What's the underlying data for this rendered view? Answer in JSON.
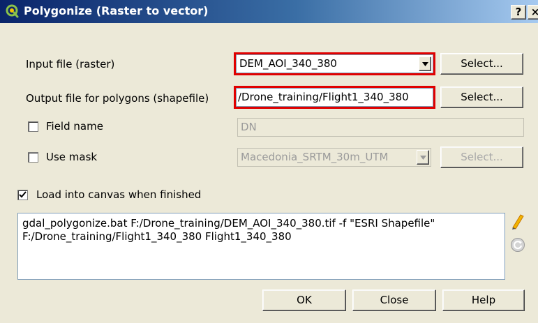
{
  "window": {
    "title": "Polygonize (Raster to vector)",
    "help_label": "?",
    "close_label": "×"
  },
  "form": {
    "input_label": "Input file (raster)",
    "input_value": "DEM_AOI_340_380",
    "input_select_label": "Select...",
    "output_label": "Output file for polygons (shapefile)",
    "output_value": "/Drone_training/Flight1_340_380",
    "output_select_label": "Select...",
    "field_name_label": "Field name",
    "field_name_checked": false,
    "field_name_value": "DN",
    "use_mask_label": "Use mask",
    "use_mask_checked": false,
    "mask_value": "Macedonia_SRTM_30m_UTM",
    "mask_select_label": "Select...",
    "load_canvas_label": "Load into canvas when finished",
    "load_canvas_checked": true
  },
  "command": {
    "text": "gdal_polygonize.bat F:/Drone_training/DEM_AOI_340_380.tif -f \"ESRI Shapefile\"\nF:/Drone_training/Flight1_340_380 Flight1_340_380"
  },
  "buttons": {
    "ok": "OK",
    "close": "Close",
    "help": "Help"
  },
  "icons": {
    "title": "qgis-logo-icon",
    "edit": "pencil-icon",
    "reset": "reset-icon"
  },
  "colors": {
    "highlight": "#e00000",
    "titlebar": "#0a246a"
  }
}
